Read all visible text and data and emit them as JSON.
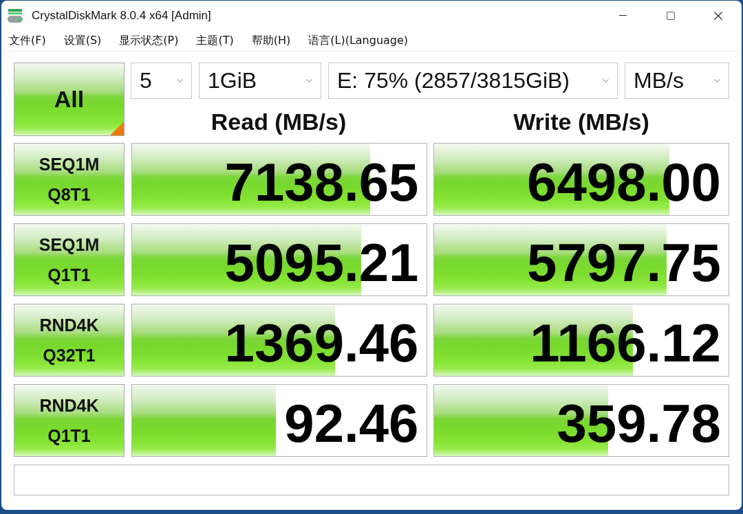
{
  "window": {
    "title": "CrystalDiskMark 8.0.4 x64 [Admin]"
  },
  "menu": [
    "文件(F)",
    "设置(S)",
    "显示状态(P)",
    "主题(T)",
    "帮助(H)",
    "语言(L)(Language)"
  ],
  "all_button": {
    "label": "All"
  },
  "settings": [
    {
      "value": "5"
    },
    {
      "value": "1GiB"
    },
    {
      "value": "E: 75% (2857/3815GiB)"
    },
    {
      "value": "MB/s"
    }
  ],
  "columns": [
    "Read (MB/s)",
    "Write (MB/s)"
  ],
  "tests": [
    {
      "name": "SEQ1M",
      "params": "Q8T1",
      "read": {
        "reading": "7138.65",
        "level": 0.81
      },
      "write": {
        "reading": "6498.00",
        "level": 0.8
      }
    },
    {
      "name": "SEQ1M",
      "params": "Q1T1",
      "read": {
        "reading": "5095.21",
        "level": 0.78
      },
      "write": {
        "reading": "5797.75",
        "level": 0.79
      }
    },
    {
      "name": "RND4K",
      "params": "Q32T1",
      "read": {
        "reading": "1369.46",
        "level": 0.69
      },
      "write": {
        "reading": "1166.12",
        "level": 0.675
      }
    },
    {
      "name": "RND4K",
      "params": "Q1T1",
      "read": {
        "reading": "92.46",
        "level": 0.49
      },
      "write": {
        "reading": "359.78",
        "level": 0.59
      }
    }
  ]
}
